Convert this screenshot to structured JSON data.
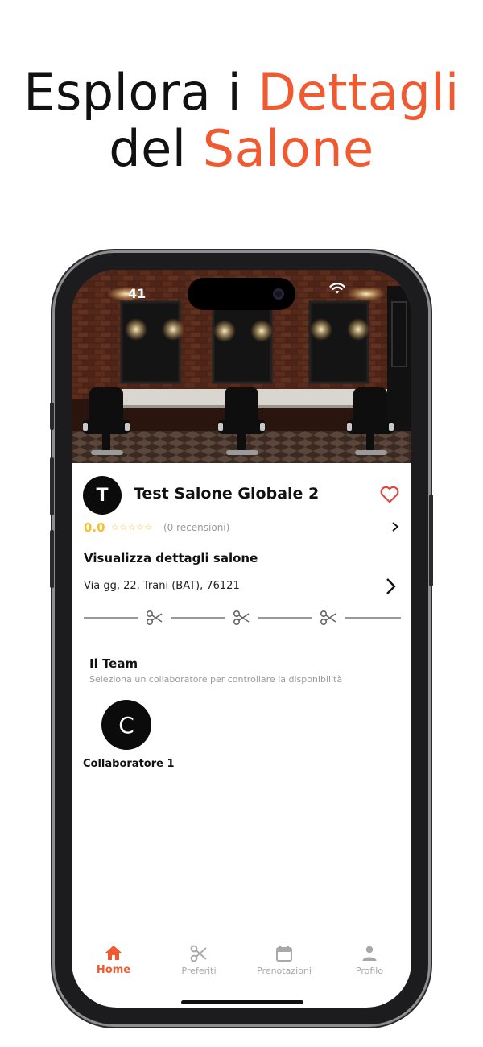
{
  "headline": {
    "line1_plain": "Esplora i ",
    "line1_accent": "Dettagli",
    "line2_plain": "del ",
    "line2_accent": "Salone"
  },
  "status_bar": {
    "time": "41"
  },
  "salon": {
    "avatar_letter": "T",
    "name": "Test Salone Globale 2",
    "rating": "0.0",
    "stars": "☆☆☆☆☆",
    "reviews": "(0 recensioni)",
    "details_title": "Visualizza dettagli salone",
    "address": "Via gg, 22, Trani (BAT), 76121"
  },
  "team": {
    "title": "Il Team",
    "subtitle": "Seleziona un collaboratore per controllare la disponibilità",
    "members": [
      {
        "initial": "C",
        "name": "Collaboratore 1"
      }
    ]
  },
  "tabs": [
    {
      "label": "Home",
      "icon": "home-icon",
      "active": true
    },
    {
      "label": "Preferiti",
      "icon": "scissors-icon",
      "active": false
    },
    {
      "label": "Prenotazioni",
      "icon": "calendar-icon",
      "active": false
    },
    {
      "label": "Profilo",
      "icon": "person-icon",
      "active": false
    }
  ],
  "colors": {
    "accent": "#f15a30",
    "rating": "#f4c22e",
    "muted": "#a8a8a8",
    "heart": "#e0483e"
  }
}
